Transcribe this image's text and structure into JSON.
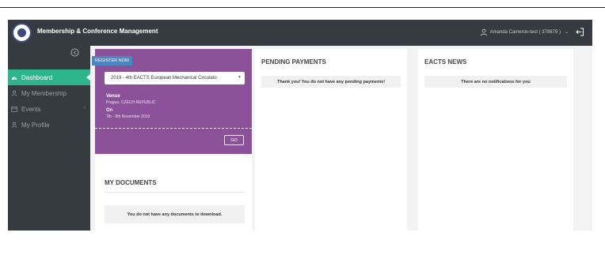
{
  "header": {
    "app_title": "Membership & Conference Management",
    "user": "Amanda Cameron-test ( 378879 )",
    "user_caret": "⌄"
  },
  "sidebar": {
    "items": [
      {
        "label": "Dashboard",
        "icon": "dashboard-icon",
        "active": true
      },
      {
        "label": "My Membership",
        "icon": "membership-icon"
      },
      {
        "label": "Events",
        "icon": "calendar-icon",
        "chevron": "›"
      },
      {
        "label": "My Profile",
        "icon": "profile-icon"
      }
    ]
  },
  "registration": {
    "ribbon": "REGISTER NOW",
    "selected_conference": "2019 - 4th EACTS European Mechanical Circulato",
    "venue_label": "Venue",
    "venue_value": "Prague, CZECH REPUBLIC",
    "on_label": "On",
    "on_value": "7th - 9th November 2019",
    "go_label": "GO"
  },
  "documents": {
    "title": "MY DOCUMENTS",
    "empty_message": "You do not have any documents to download."
  },
  "pending": {
    "title": "PENDING PAYMENTS",
    "message": "Thank you! You do not have any pending payments!"
  },
  "news": {
    "title": "EACTS NEWS",
    "message": "There are no notifications for you"
  },
  "colors": {
    "header_bg": "#353b40",
    "active_nav": "#2fb58b",
    "register_card": "#8c5299",
    "ribbon": "#4a86c2"
  }
}
